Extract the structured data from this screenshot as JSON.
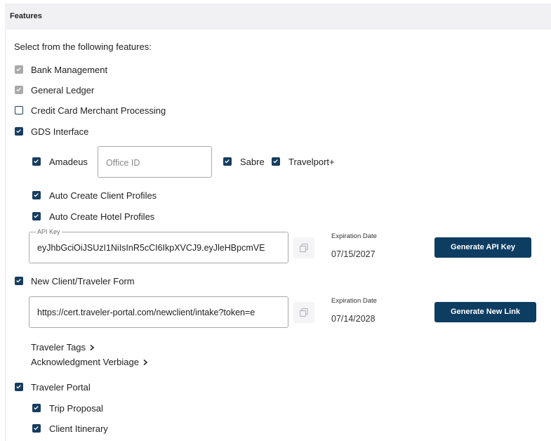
{
  "section": {
    "title": "Features",
    "intro": "Select from the following features:"
  },
  "features": {
    "bank_management": {
      "label": "Bank Management",
      "state": "checked-disabled"
    },
    "general_ledger": {
      "label": "General Ledger",
      "state": "checked-disabled"
    },
    "credit_card": {
      "label": "Credit Card Merchant Processing",
      "state": "unchecked"
    },
    "gds": {
      "label": "GDS Interface",
      "state": "checked"
    },
    "amadeus": {
      "label": "Amadeus",
      "state": "checked"
    },
    "office_id": {
      "placeholder": "Office ID",
      "value": ""
    },
    "sabre": {
      "label": "Sabre",
      "state": "checked"
    },
    "travelport": {
      "label": "Travelport+",
      "state": "checked"
    },
    "auto_client": {
      "label": "Auto Create Client Profiles",
      "state": "checked"
    },
    "auto_hotel": {
      "label": "Auto Create Hotel Profiles",
      "state": "checked"
    },
    "api_key": {
      "legend": "API Key",
      "value": "eyJhbGciOiJSUzI1NiIsInR5cCI6IkpXVCJ9.eyJleHBpcmVE",
      "expiration_label": "Expiration Date",
      "expiration_date": "07/15/2027",
      "button": "Generate API Key"
    },
    "new_client_form": {
      "label": "New Client/Traveler Form",
      "state": "checked"
    },
    "form_link": {
      "value": "https://cert.traveler-portal.com/newclient/intake?token=e",
      "expiration_label": "Expiration Date",
      "expiration_date": "07/14/2028",
      "button": "Generate New Link"
    },
    "traveler_tags": {
      "label": "Traveler Tags"
    },
    "ack_verbiage": {
      "label": "Acknowledgment Verbiage"
    },
    "traveler_portal": {
      "label": "Traveler Portal",
      "state": "checked"
    },
    "trip_proposal": {
      "label": "Trip Proposal",
      "state": "checked"
    },
    "client_itinerary": {
      "label": "Client Itinerary",
      "state": "checked"
    }
  },
  "colors": {
    "accent": "#0e3d62",
    "checkbox": "#173d5f",
    "disabled": "#a9a9a9",
    "header_bg": "#f1f1f3"
  }
}
